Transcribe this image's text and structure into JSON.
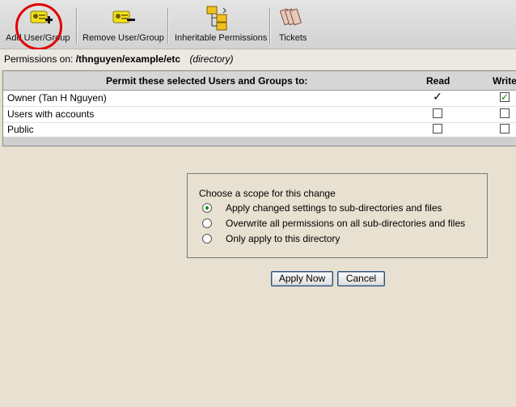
{
  "toolbar": {
    "add_label": "Add User/Group",
    "remove_label": "Remove User/Group",
    "inheritable_label": "Inheritable Permissions",
    "tickets_label": "Tickets"
  },
  "permissions": {
    "prefix": "Permissions on:",
    "path": "/thnguyen/example/etc",
    "kind": "(directory)"
  },
  "table": {
    "headers": {
      "permit": "Permit these selected Users and Groups to:",
      "read": "Read",
      "write": "Write"
    },
    "rows": [
      {
        "name": "Owner (Tan H Nguyen)",
        "read": true,
        "write": true
      },
      {
        "name": "Users with accounts",
        "read": false,
        "write": false
      },
      {
        "name": "Public",
        "read": false,
        "write": false
      }
    ]
  },
  "scope": {
    "title": "Choose a scope for this change",
    "options": [
      "Apply changed settings to sub-directories and files",
      "Overwrite all permissions on all sub-directories and files",
      "Only apply to this directory"
    ],
    "selected_index": 0
  },
  "buttons": {
    "apply": "Apply Now",
    "cancel": "Cancel"
  },
  "colors": {
    "background": "#e8e0d0",
    "highlight_circle": "#e00000",
    "check_green": "#0a8a0a"
  }
}
